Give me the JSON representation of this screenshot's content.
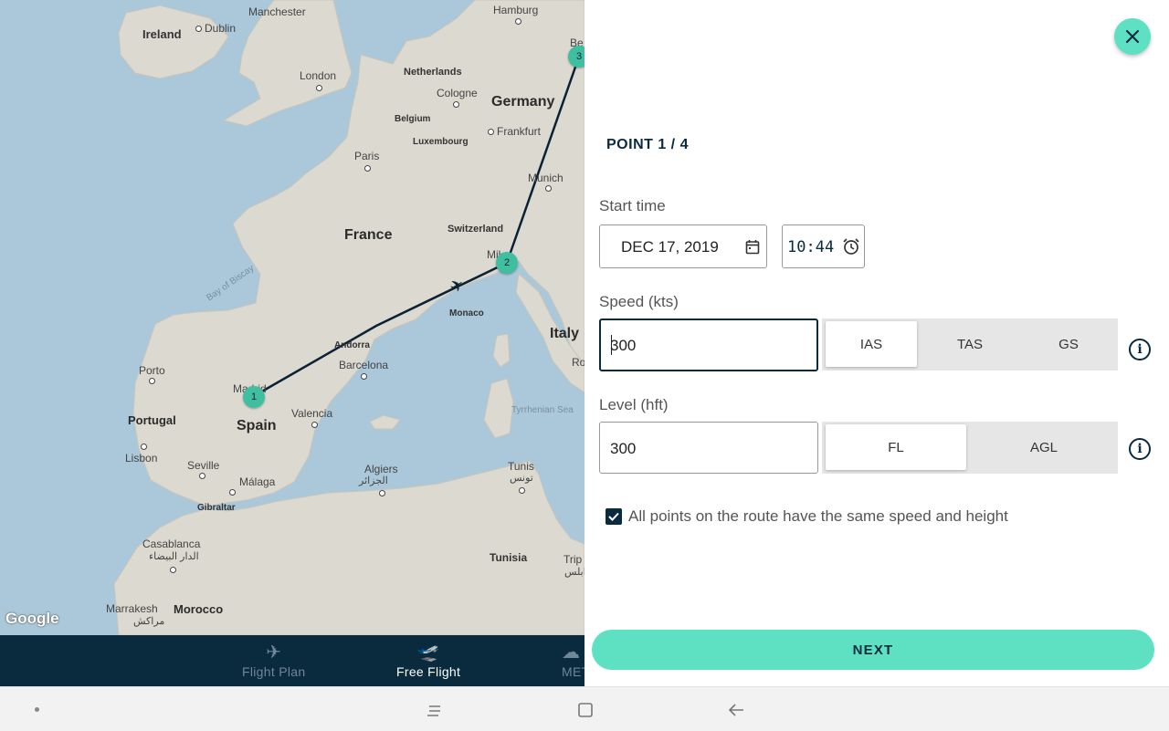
{
  "map": {
    "labels": {
      "manchester": "Manchester",
      "ireland": "Ireland",
      "dublin": "Dublin",
      "hamburg": "Hamburg",
      "london": "London",
      "netherlands": "Netherlands",
      "cologne": "Cologne",
      "germany": "Germany",
      "belgium": "Belgium",
      "frankfurt": "Frankfurt",
      "luxembourg": "Luxembourg",
      "paris": "Paris",
      "munich": "Munich",
      "france": "France",
      "switzerland": "Switzerland",
      "bay_of_biscay": "Bay of Biscay",
      "milan": "Mil",
      "monaco": "Monaco",
      "italy": "Italy",
      "porto": "Porto",
      "andorra": "Andorra",
      "barcelona": "Barcelona",
      "rome": "Ro",
      "madrid": "Madrid",
      "portugal": "Portugal",
      "spain": "Spain",
      "valencia": "Valencia",
      "tyrrhenian": "Tyrrhenian Sea",
      "lisbon": "Lisbon",
      "seville": "Seville",
      "algiers": "Algiers",
      "algiers_ar": "الجزائر",
      "tunis": "Tunis",
      "tunis_ar": "تونس",
      "malaga": "Málaga",
      "gibraltar": "Gibraltar",
      "casablanca": "Casablanca",
      "casablanca_ar": "الدار البيضاء",
      "tunisia": "Tunisia",
      "tripoli": "Trip",
      "tripoli_ar": "طرابلس",
      "marrakesh": "Marrakesh",
      "marrakesh_ar": "مراكش",
      "morocco": "Morocco",
      "berlin": "Be",
      "google": "Google"
    },
    "waypoints": [
      "1",
      "2",
      "3"
    ]
  },
  "bottom_nav": {
    "items": [
      {
        "label": "Flight Plan",
        "icon": "flight-plan-icon"
      },
      {
        "label": "Free Flight",
        "icon": "free-flight-icon"
      },
      {
        "label": "MET",
        "icon": "met-icon"
      }
    ],
    "active": "Free Flight"
  },
  "system_bar": {
    "recents_icon": "recents-icon",
    "home_icon": "home-icon",
    "back_icon": "back-icon"
  },
  "panel": {
    "close_icon": "close-icon",
    "point_title": "POINT 1 / 4",
    "start_time_label": "Start time",
    "date_value": "DEC 17, 2019",
    "time_value": "10:44",
    "speed_label": "Speed (kts)",
    "speed_value": "300",
    "speed_options": [
      "IAS",
      "TAS",
      "GS"
    ],
    "speed_selected": "IAS",
    "level_label": "Level (hft)",
    "level_value": "300",
    "level_options": [
      "FL",
      "AGL"
    ],
    "level_selected": "FL",
    "same_speed_checkbox_label": "All points on the route have the same speed and height",
    "same_speed_checked": true,
    "next_label": "NEXT"
  },
  "colors": {
    "accent": "#5ee0c3",
    "navy": "#0a2a3e",
    "marker": "#3fbfa0",
    "sea": "#aac8d9",
    "land": "#dedbd3"
  }
}
